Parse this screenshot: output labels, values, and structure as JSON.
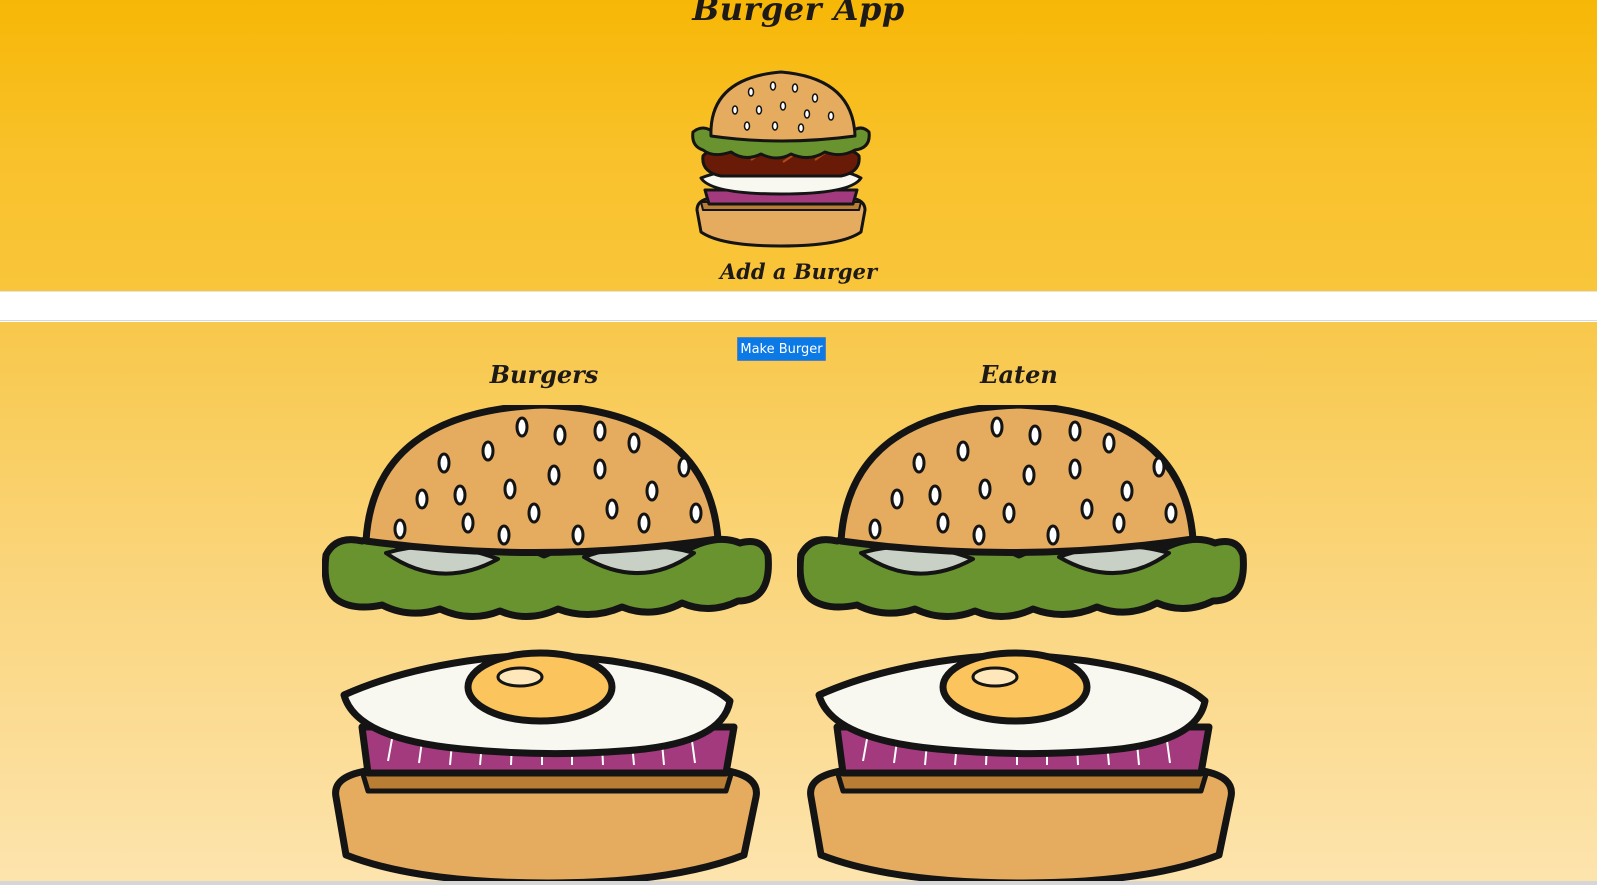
{
  "header": {
    "title": "Burger App",
    "add_label": "Add a Burger"
  },
  "form": {
    "input_value": "",
    "input_placeholder": "",
    "submit_label": "Make Burger"
  },
  "columns": {
    "burgers": {
      "title": "Burgers"
    },
    "eaten": {
      "title": "Eaten"
    }
  },
  "icons": {
    "hero": "burger-icon",
    "burgers_column": "burger-icon",
    "eaten_column": "burger-icon"
  },
  "colors": {
    "header_gradient_top": "#f7b706",
    "content_gradient_top": "#f8c84a",
    "content_gradient_bottom": "#fde4ae",
    "button_blue": "#0b79e6",
    "bun": "#e5ab5e",
    "lettuce": "#68932f",
    "onion": "#a33a7e",
    "patty": "#6a1b07"
  }
}
